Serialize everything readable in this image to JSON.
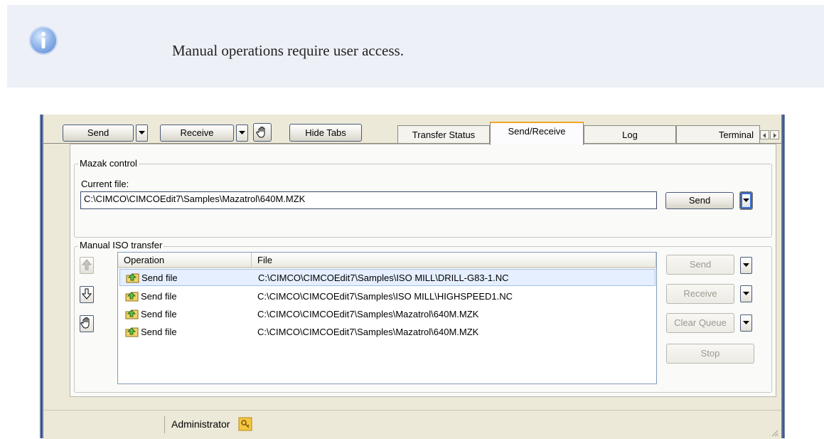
{
  "note": {
    "icon": "info-icon",
    "text": "Manual operations require user access."
  },
  "toolbar": {
    "send_label": "Send",
    "receive_label": "Receive",
    "hide_tabs_label": "Hide Tabs",
    "hand_icon": "hand-icon"
  },
  "tabs": [
    {
      "label": "Transfer Status",
      "active": false
    },
    {
      "label": "Send/Receive",
      "active": true
    },
    {
      "label": "Log",
      "active": false
    },
    {
      "label": "Terminal",
      "active": false
    }
  ],
  "mazak": {
    "legend": "Mazak control",
    "current_file_label": "Current file:",
    "current_file_value": "C:\\CIMCO\\CIMCOEdit7\\Samples\\Mazatrol\\640M.MZK",
    "send_label": "Send"
  },
  "iso": {
    "legend": "Manual ISO transfer",
    "columns": [
      "Operation",
      "File"
    ],
    "rows": [
      {
        "operation": "Send file",
        "file": "C:\\CIMCO\\CIMCOEdit7\\Samples\\ISO MILL\\DRILL-G83-1.NC",
        "selected": true
      },
      {
        "operation": "Send file",
        "file": "C:\\CIMCO\\CIMCOEdit7\\Samples\\ISO MILL\\HIGHSPEED1.NC",
        "selected": false
      },
      {
        "operation": "Send file",
        "file": "C:\\CIMCO\\CIMCOEdit7\\Samples\\Mazatrol\\640M.MZK",
        "selected": false
      },
      {
        "operation": "Send file",
        "file": "C:\\CIMCO\\CIMCOEdit7\\Samples\\Mazatrol\\640M.MZK",
        "selected": false
      }
    ],
    "send_label": "Send",
    "receive_label": "Receive",
    "clear_queue_label": "Clear Queue",
    "stop_label": "Stop"
  },
  "status": {
    "user": "Administrator"
  },
  "colors": {
    "accent_tab": "#f5a623",
    "selection": "#e5efff",
    "window_frame": "#6b7ea8"
  }
}
